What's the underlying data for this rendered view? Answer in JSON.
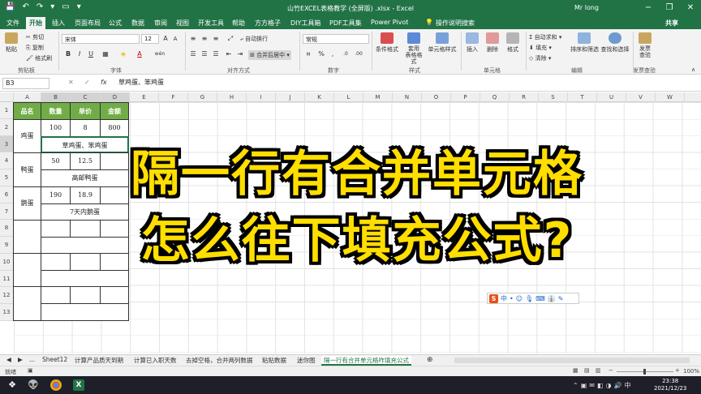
{
  "window": {
    "title": "山竹EXCEL表格教学 (全屏版) .xlsx - Excel",
    "user": "Mr long",
    "controls": [
      "−",
      "❐",
      "✕"
    ],
    "qa": [
      "💾",
      "↶",
      "↷",
      "▾",
      "▭",
      "▾"
    ]
  },
  "tabs": [
    "文件",
    "开始",
    "插入",
    "页面布局",
    "公式",
    "数据",
    "审阅",
    "视图",
    "开发工具",
    "帮助",
    "方方格子",
    "DIY工具箱",
    "PDF工具集",
    "Power Pivot",
    "操作说明搜索"
  ],
  "share": "共享",
  "ribbon": {
    "clipboard": {
      "paste": "粘贴",
      "cut": "剪切",
      "copy": "复制",
      "format_painter": "格式刷",
      "label": "剪贴板"
    },
    "font": {
      "name": "宋体",
      "size": "12",
      "bold": "B",
      "italic": "I",
      "underline": "U",
      "wen": "wén",
      "label": "字体"
    },
    "align": {
      "wrap": "自动换行",
      "merge": "合并后居中",
      "label": "对齐方式"
    },
    "number": {
      "format": "常规",
      "label": "数字"
    },
    "styles": {
      "cond": "条件格式",
      "table": "套用\n表格格式",
      "cell": "单元格样式",
      "label": "样式"
    },
    "cells": {
      "insert": "插入",
      "delete": "删除",
      "format": "格式",
      "label": "单元格"
    },
    "editing": {
      "autosum": "自动求和",
      "fill": "填充",
      "clear": "清除",
      "sort": "排序和筛选",
      "find": "查找和选择",
      "label": "编辑"
    },
    "invoice": {
      "btn": "发票\n查验",
      "label": "发票查验"
    }
  },
  "formula": {
    "namebox": "B3",
    "x": "✕",
    "check": "✓",
    "fx": "fx",
    "value": "草鸡蛋、笨鸡蛋"
  },
  "columns": [
    "A",
    "B",
    "C",
    "D",
    "E",
    "F",
    "G",
    "H",
    "I",
    "J",
    "K",
    "L",
    "M",
    "N",
    "O",
    "P",
    "Q",
    "R",
    "S",
    "T",
    "U",
    "V",
    "W"
  ],
  "rows": [
    "1",
    "2",
    "3",
    "4",
    "5",
    "6",
    "7",
    "8",
    "9",
    "10",
    "11",
    "12",
    "13"
  ],
  "table": {
    "headers": [
      "品名",
      "数量",
      "单价",
      "金额"
    ],
    "r2": [
      "鸡蛋",
      "100",
      "8",
      "800"
    ],
    "r3": "草鸡蛋、笨鸡蛋",
    "r4": [
      "鸭蛋",
      "50",
      "12.5"
    ],
    "r5": "高邮鸭蛋",
    "r6": [
      "鹅蛋",
      "190",
      "18.9"
    ],
    "r7": "7天内鹅蛋"
  },
  "overlay": {
    "line1": "隔一行有合并单元格",
    "line2": "怎么往下填充公式?"
  },
  "ime": [
    "S",
    "中",
    "•",
    "☺",
    "🎙",
    "⌨",
    "👔",
    "✎"
  ],
  "sheets": [
    "◀",
    "▶",
    "...",
    "Sheet12",
    "计算产品质天到期",
    "计算已入职天数",
    "去掉空格，合并两列数据",
    "粘贴数据",
    "迷你图",
    "隔一行有合并单元格咋填充公式",
    "⊕"
  ],
  "status": {
    "mode": "就绪",
    "zoom": "100%"
  },
  "clock": {
    "time": "23:38",
    "date": "2021/12/23"
  }
}
